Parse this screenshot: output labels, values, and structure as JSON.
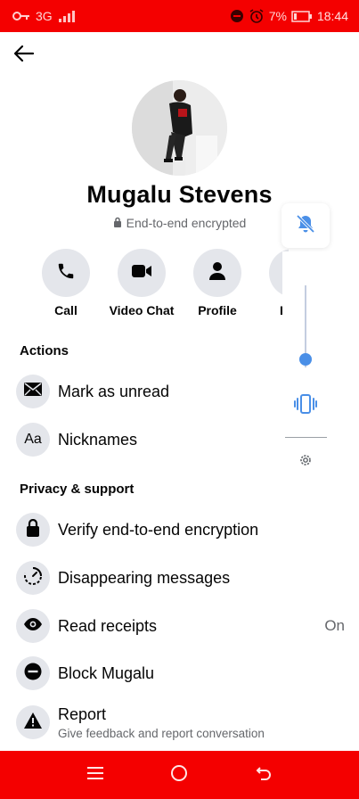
{
  "status_bar": {
    "network": "3G",
    "battery": "7%",
    "time": "18:44",
    "icons": [
      "key-icon",
      "signal-icon",
      "dnd-icon",
      "alarm-icon",
      "battery-icon"
    ]
  },
  "profile": {
    "name": "Mugalu Stevens",
    "encryption_label": "End-to-end encrypted"
  },
  "quick_actions": [
    {
      "label": "Call",
      "icon": "phone-icon"
    },
    {
      "label": "Video Chat",
      "icon": "video-camera-icon"
    },
    {
      "label": "Profile",
      "icon": "person-icon"
    },
    {
      "label": "I",
      "icon": "more-icon"
    }
  ],
  "actions_section": {
    "title": "Actions",
    "items": [
      {
        "label": "Mark as unread",
        "icon": "envelope-icon"
      },
      {
        "label": "Nicknames",
        "icon": "text-aa-icon",
        "icon_text": "Aa"
      }
    ]
  },
  "privacy_section": {
    "title": "Privacy & support",
    "items": [
      {
        "label": "Verify end-to-end encryption",
        "icon": "lock-icon"
      },
      {
        "label": "Disappearing messages",
        "icon": "timer-icon"
      },
      {
        "label": "Read receipts",
        "icon": "eye-icon",
        "value": "On"
      },
      {
        "label": "Block Mugalu",
        "icon": "block-icon"
      },
      {
        "label": "Report",
        "sublabel": "Give feedback and report conversation",
        "icon": "warning-icon"
      }
    ]
  },
  "volume_panel": {
    "mode": "muted",
    "level": 0.1,
    "icons": [
      "bell-muted-icon",
      "vibrate-icon",
      "gear-icon"
    ]
  },
  "colors": {
    "system_bar": "#f40000",
    "icon_bg": "#e4e6eb",
    "accent": "#4a8fe7",
    "secondary_text": "#65676b"
  }
}
